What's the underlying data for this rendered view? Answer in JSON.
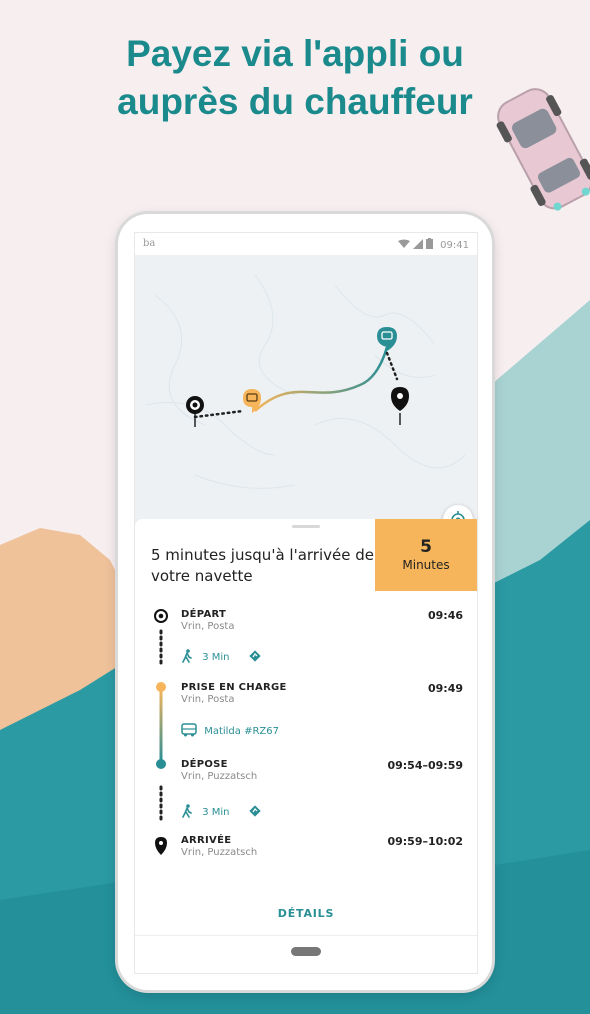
{
  "headline": {
    "line1": "Payez via l'appli ou",
    "line2": "auprès du chauffeur"
  },
  "status_bar": {
    "left": "ba",
    "time": "09:41",
    "icons": [
      "wifi-icon",
      "signal-icon",
      "battery-icon"
    ]
  },
  "eta": {
    "message": "5 minutes jusqu'à l'arrivée de votre navette",
    "value": "5",
    "unit": "Minutes"
  },
  "itinerary": [
    {
      "label": "DÉPART",
      "place": "Vrin, Posta",
      "time": "09:46",
      "icon": "origin-icon"
    },
    {
      "label": "PRISE EN CHARGE",
      "place": "Vrin, Posta",
      "time": "09:49",
      "icon": "pickup-icon"
    },
    {
      "label": "DÉPOSE",
      "place": "Vrin, Puzzatsch",
      "time": "09:54–09:59",
      "icon": "dropoff-icon"
    },
    {
      "label": "ARRIVÉE",
      "place": "Vrin, Puzzatsch",
      "time": "09:59–10:02",
      "icon": "destination-pin-icon"
    }
  ],
  "walk_1": {
    "text": "3 Min"
  },
  "walk_2": {
    "text": "3 Min"
  },
  "vehicle": {
    "text": "Matilda #RZ67"
  },
  "details_label": "DÉTAILS",
  "colors": {
    "brand_teal": "#1a8a8c",
    "accent_orange": "#f6b55a",
    "route_teal": "#2a8f95",
    "background_pink": "#f7eef0"
  }
}
